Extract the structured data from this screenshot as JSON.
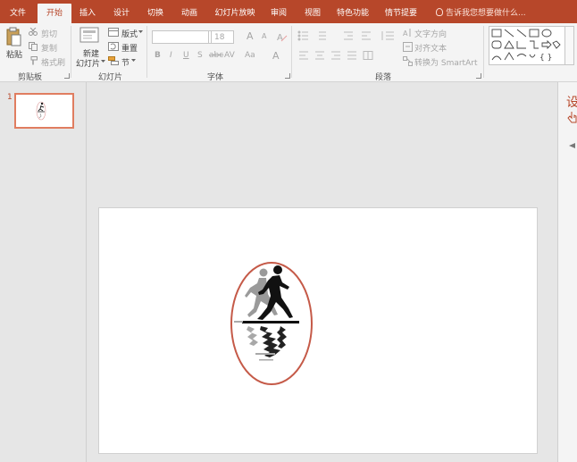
{
  "tabs": [
    {
      "label": "文件"
    },
    {
      "label": "开始"
    },
    {
      "label": "插入"
    },
    {
      "label": "设计"
    },
    {
      "label": "切换"
    },
    {
      "label": "动画"
    },
    {
      "label": "幻灯片放映"
    },
    {
      "label": "审阅"
    },
    {
      "label": "视图"
    },
    {
      "label": "特色功能"
    },
    {
      "label": "情节提要"
    }
  ],
  "active_tab": "开始",
  "tell_me": "告诉我您想要做什么...",
  "clipboard": {
    "paste": "粘贴",
    "cut": "剪切",
    "copy": "复制",
    "format_painter": "格式刷",
    "group_label": "剪贴板"
  },
  "slides_group": {
    "new_slide_line1": "新建",
    "new_slide_line2": "幻灯片",
    "layout": "版式",
    "reset": "重置",
    "section": "节",
    "group_label": "幻灯片"
  },
  "font": {
    "font_size": "18",
    "bold": "B",
    "italic": "I",
    "underline": "U",
    "shadow": "S",
    "strikethrough": "abc",
    "spacing": "AV",
    "case": "Aa",
    "color": "A",
    "grow": "A",
    "shrink": "A",
    "group_label": "字体"
  },
  "paragraph": {
    "text_direction": "文字方向",
    "align_text": "对齐文本",
    "smartart": "转换为 SmartArt",
    "group_label": "段落"
  },
  "right_pane": {
    "title": "设"
  },
  "slide_panel": {
    "slide_number": "1"
  },
  "colors": {
    "accent": "#b7472a",
    "ribbon_bg": "#f4f4f4",
    "workspace_bg": "#e6e6e6",
    "oval_outline": "#c55a48",
    "figure": "#111111",
    "shadow_figure": "#9a9a9a"
  }
}
